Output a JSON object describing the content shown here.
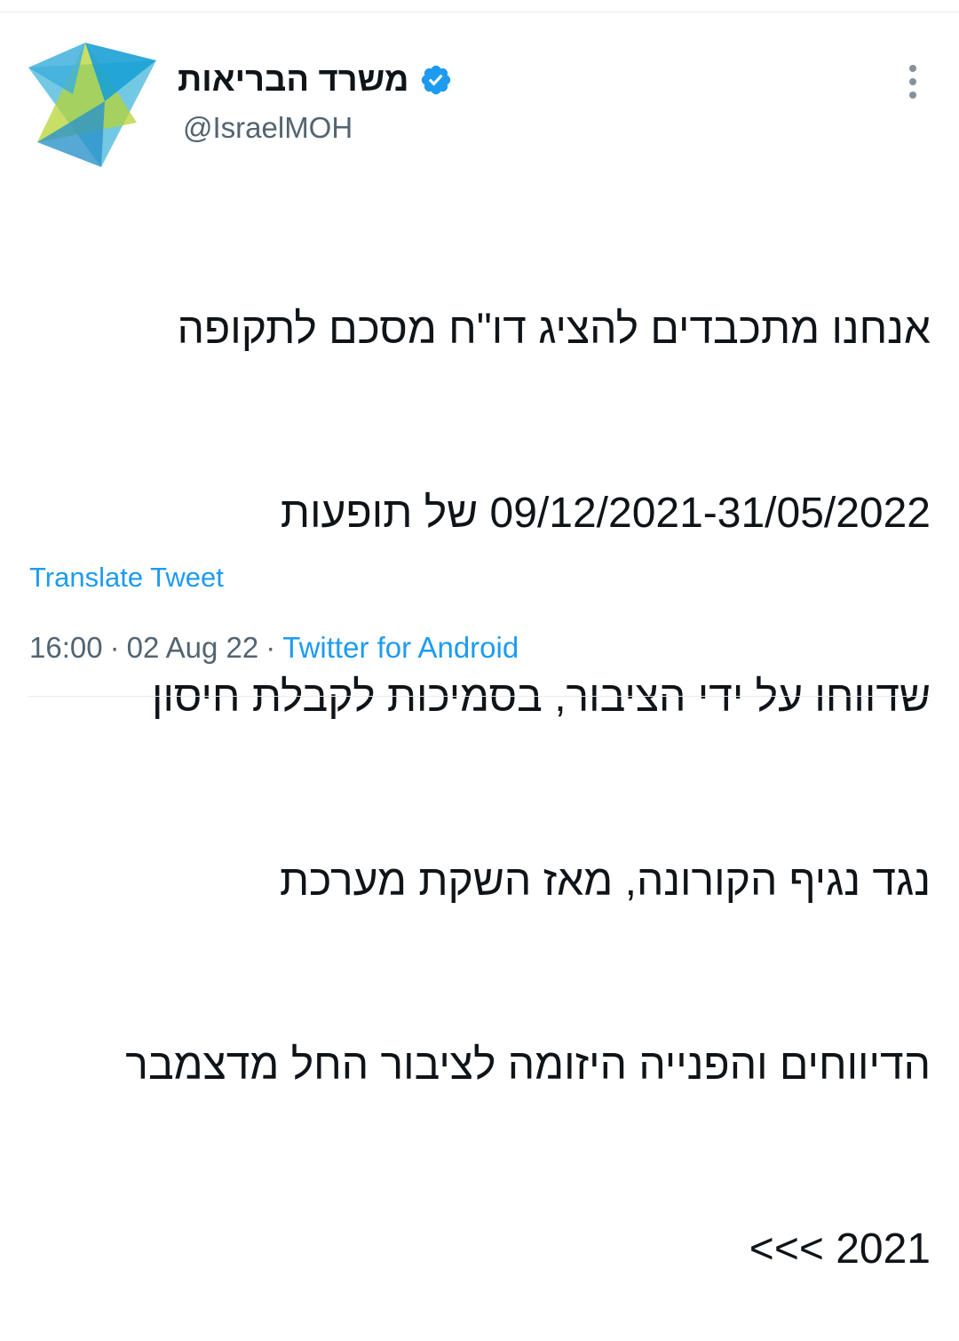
{
  "tweet": {
    "author": {
      "display_name": "משרד הבריאות",
      "handle": "@IsraelMOH",
      "verified": true,
      "avatar_icon": "israel-moh-logo-icon"
    },
    "text_lines": [
      "אנחנו מתכבדים להציג דו\"ח מסכם לתקופה",
      "09/12/2021-31/05/2022 של תופעות",
      "שדווחו על ידי הציבור,  בסמיכות לקבלת חיסון",
      "נגד נגיף הקורונה, מאז השקת מערכת",
      "הדיווחים והפנייה היזומה לציבור החל מדצמבר",
      "2021 >>>"
    ],
    "translate_label": "Translate Tweet",
    "time": "16:00",
    "separator": "·",
    "date": "02 Aug 22",
    "source": "Twitter for Android"
  },
  "colors": {
    "link": "#1d9bf0",
    "secondary_text": "#536471",
    "verified_badge": "#1d9bf0",
    "divider": "#e6ecf0"
  },
  "icons": {
    "verified": "verified-badge-icon",
    "more": "more-options-icon"
  }
}
